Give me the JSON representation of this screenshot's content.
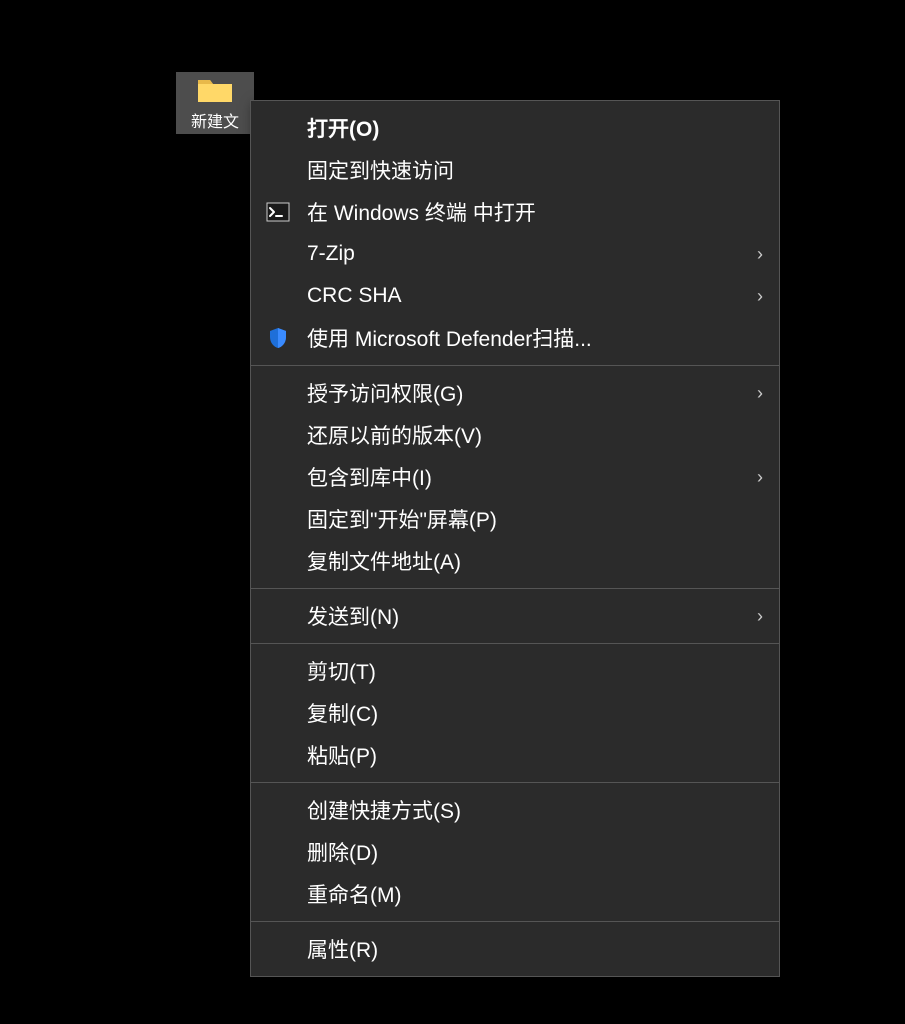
{
  "desktop_icon": {
    "label": "新建文"
  },
  "context_menu": {
    "groups": [
      [
        {
          "label": "打开(O)",
          "bold": true,
          "icon": null,
          "submenu": false
        },
        {
          "label": "固定到快速访问",
          "bold": false,
          "icon": null,
          "submenu": false
        },
        {
          "label": "在 Windows 终端 中打开",
          "bold": false,
          "icon": "terminal",
          "submenu": false
        },
        {
          "label": "7-Zip",
          "bold": false,
          "icon": null,
          "submenu": true
        },
        {
          "label": "CRC SHA",
          "bold": false,
          "icon": null,
          "submenu": true
        },
        {
          "label": "使用 Microsoft Defender扫描...",
          "bold": false,
          "icon": "shield",
          "submenu": false
        }
      ],
      [
        {
          "label": "授予访问权限(G)",
          "bold": false,
          "icon": null,
          "submenu": true
        },
        {
          "label": "还原以前的版本(V)",
          "bold": false,
          "icon": null,
          "submenu": false
        },
        {
          "label": "包含到库中(I)",
          "bold": false,
          "icon": null,
          "submenu": true
        },
        {
          "label": "固定到\"开始\"屏幕(P)",
          "bold": false,
          "icon": null,
          "submenu": false
        },
        {
          "label": "复制文件地址(A)",
          "bold": false,
          "icon": null,
          "submenu": false
        }
      ],
      [
        {
          "label": "发送到(N)",
          "bold": false,
          "icon": null,
          "submenu": true
        }
      ],
      [
        {
          "label": "剪切(T)",
          "bold": false,
          "icon": null,
          "submenu": false
        },
        {
          "label": "复制(C)",
          "bold": false,
          "icon": null,
          "submenu": false
        },
        {
          "label": "粘贴(P)",
          "bold": false,
          "icon": null,
          "submenu": false
        }
      ],
      [
        {
          "label": "创建快捷方式(S)",
          "bold": false,
          "icon": null,
          "submenu": false
        },
        {
          "label": "删除(D)",
          "bold": false,
          "icon": null,
          "submenu": false
        },
        {
          "label": "重命名(M)",
          "bold": false,
          "icon": null,
          "submenu": false
        }
      ],
      [
        {
          "label": "属性(R)",
          "bold": false,
          "icon": null,
          "submenu": false
        }
      ]
    ]
  }
}
